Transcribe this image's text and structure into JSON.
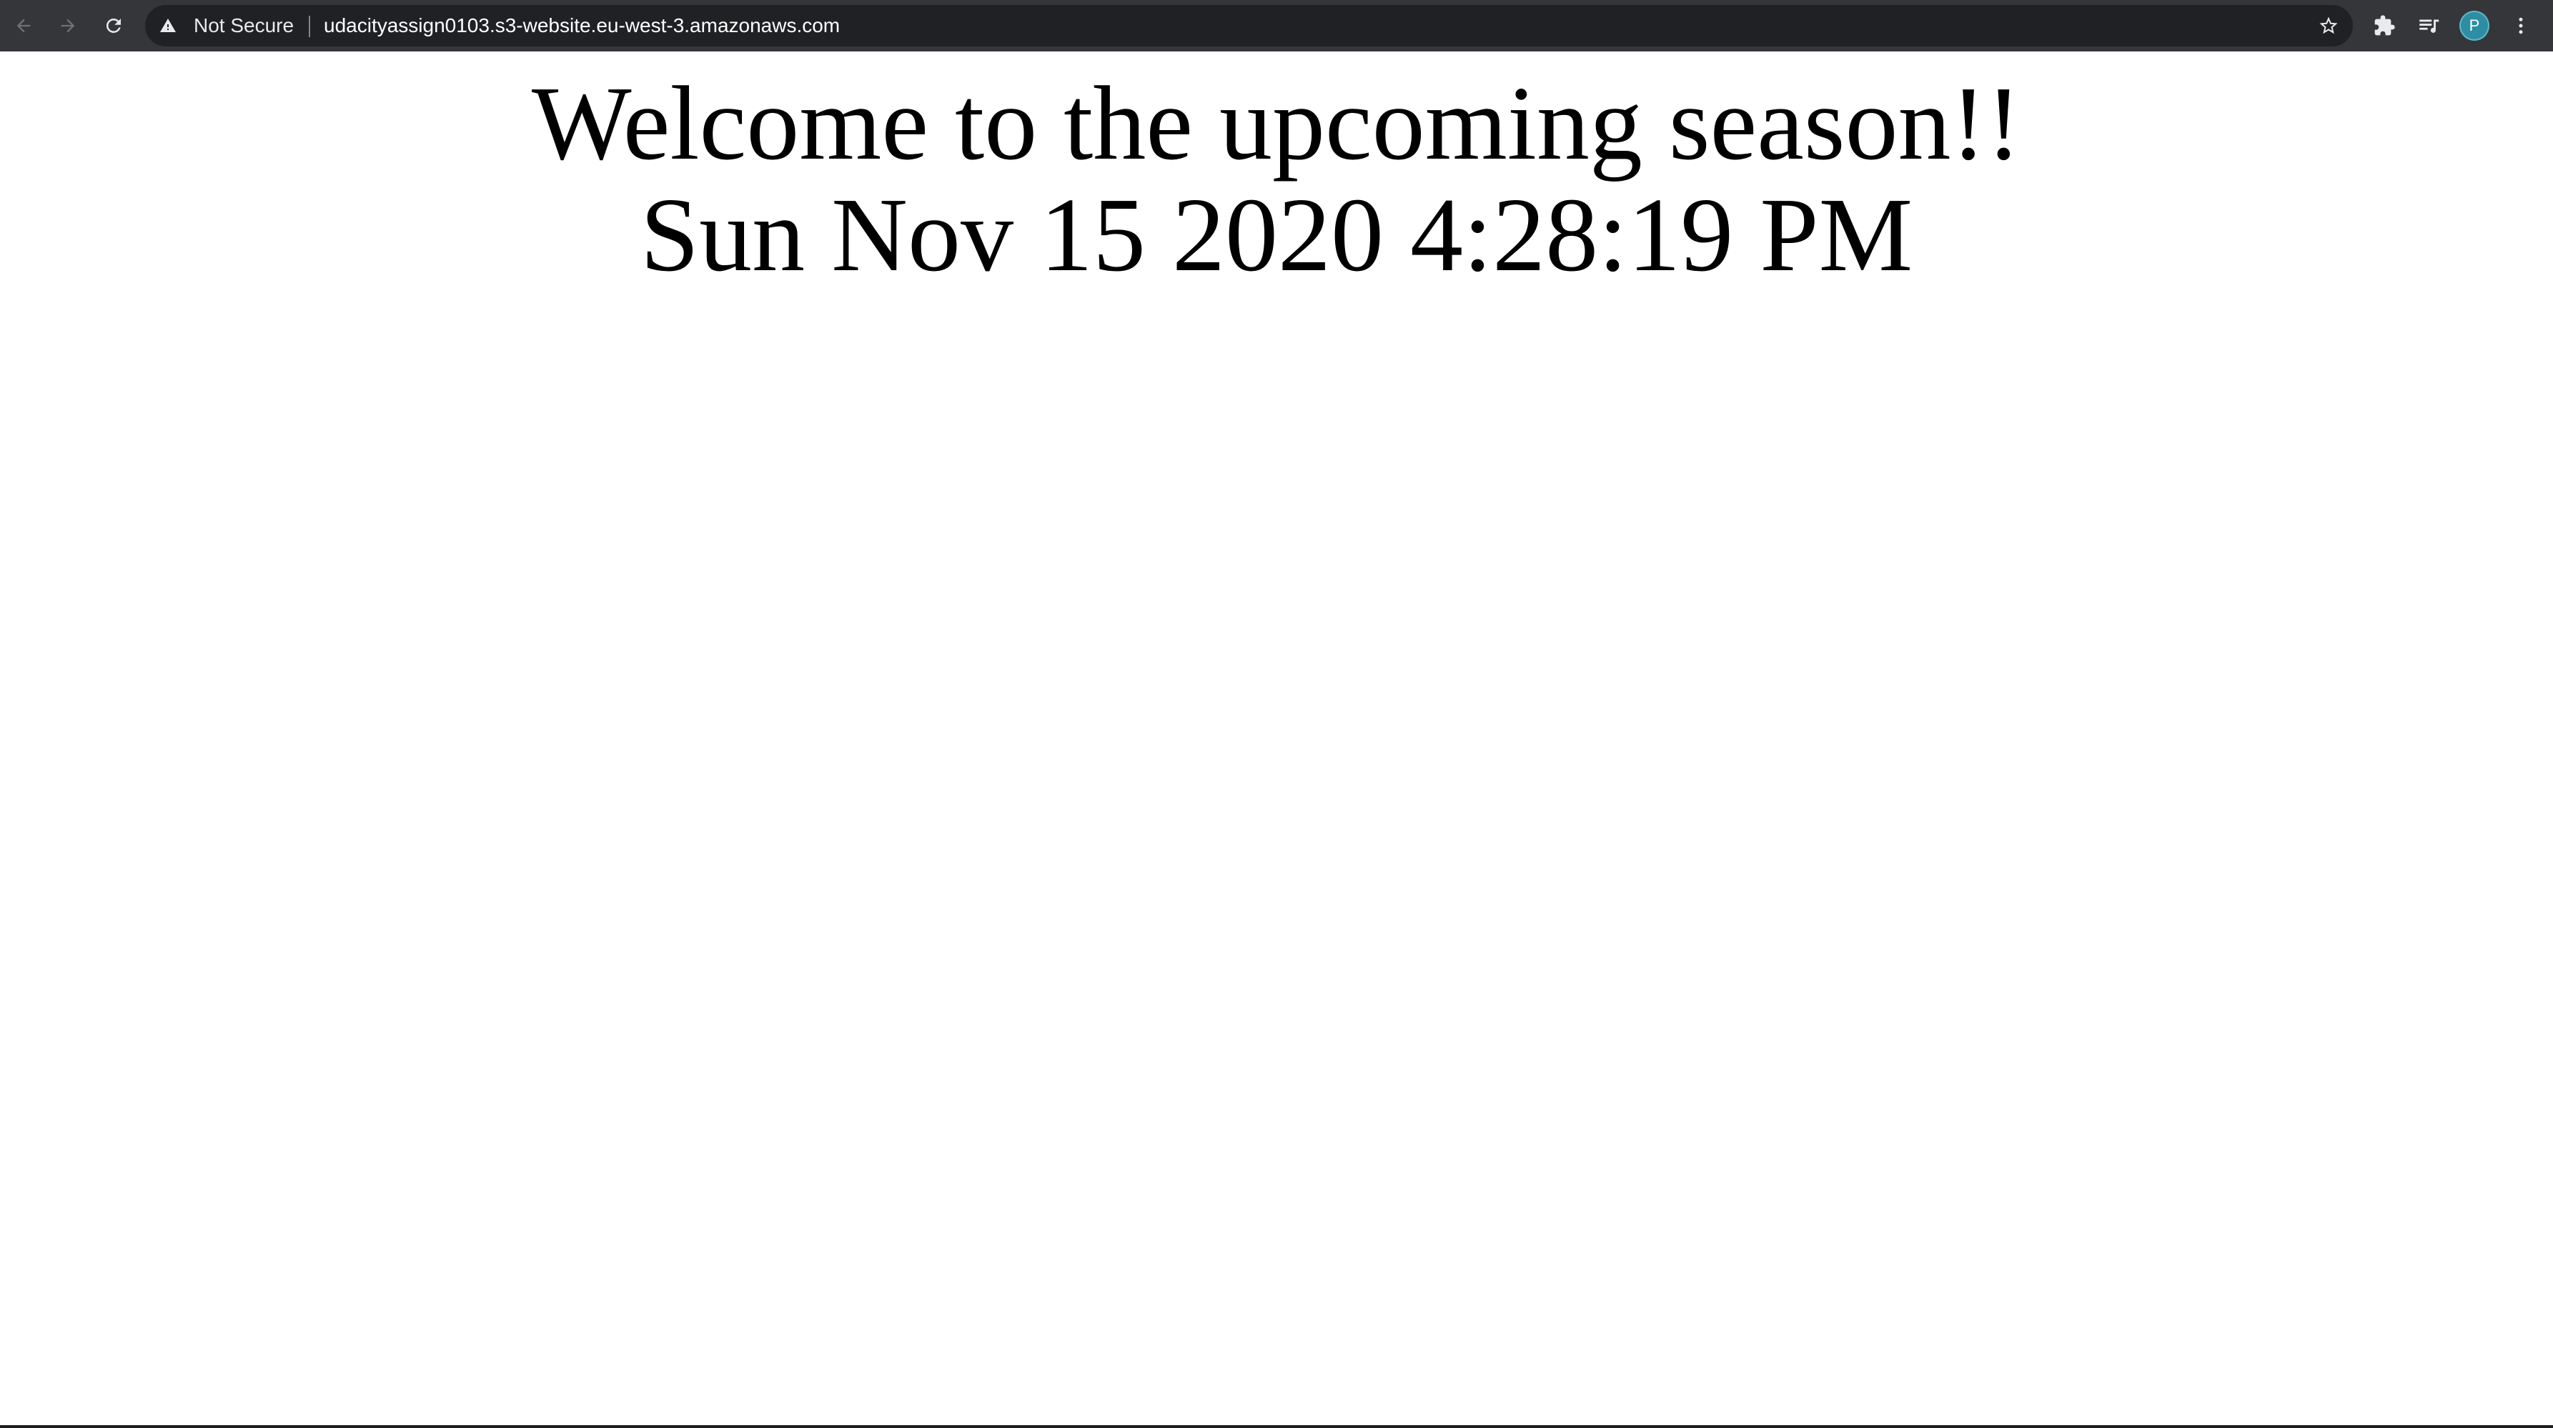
{
  "browser": {
    "security_label": "Not Secure",
    "url": "udacityassign0103.s3-website.eu-west-3.amazonaws.com",
    "profile_initial": "P",
    "colors": {
      "toolbar": "#35363a",
      "omnibox": "#202124",
      "avatar": "#2d8ea3"
    },
    "icons": {
      "back": "arrow-left-icon",
      "forward": "arrow-right-icon",
      "reload": "reload-icon",
      "security": "warning-triangle-icon",
      "bookmark": "star-icon",
      "extensions": "puzzle-icon",
      "media": "media-queue-icon",
      "menu": "kebab-menu-icon"
    }
  },
  "page": {
    "heading": "Welcome to the upcoming season!!",
    "datetime": "Sun Nov 15 2020 4:28:19 PM"
  }
}
